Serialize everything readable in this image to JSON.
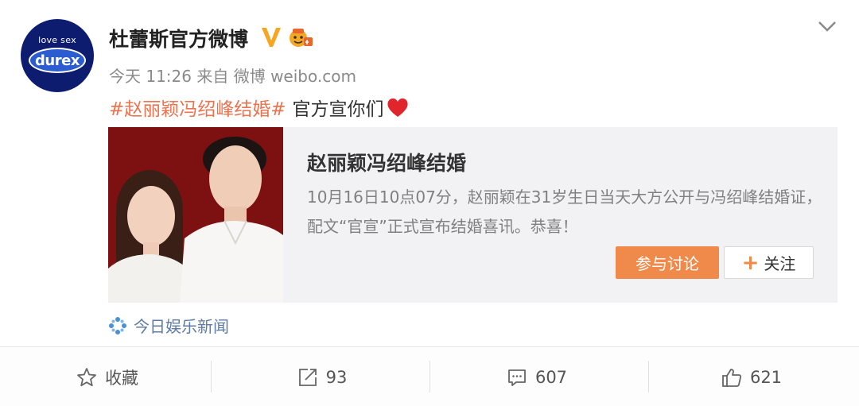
{
  "header": {
    "avatar": {
      "tagline": "love sex",
      "brand": "durex"
    },
    "user_name": "杜蕾斯官方微博",
    "meta": "今天 11:26 来自 微博 weibo.com"
  },
  "post": {
    "hashtag": "#赵丽颖冯绍峰结婚#",
    "body": "官方宣你们"
  },
  "link_card": {
    "title": "赵丽颖冯绍峰结婚",
    "description": "10月16日10点07分，赵丽颖在31岁生日当天大方公开与冯绍峰结婚证，配文“官宣”正式宣布结婚喜讯。恭喜！",
    "join_label": "参与讨论",
    "follow_label": "关注"
  },
  "source": {
    "label": "今日娱乐新闻"
  },
  "footer": {
    "favorite_label": "收藏",
    "repost_count": "93",
    "comment_count": "607",
    "like_count": "621"
  },
  "colors": {
    "accent": "#eb7350",
    "button": "#f08a4b",
    "verified": "#f5a623",
    "link": "#5d7ba4",
    "durex_blue": "#0d1c6e"
  }
}
